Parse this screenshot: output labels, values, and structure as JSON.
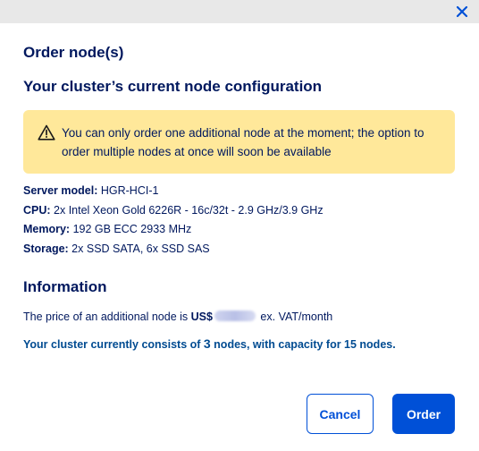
{
  "modal": {
    "title": "Order node(s)",
    "close_icon": "close-icon"
  },
  "config": {
    "title": "Your cluster’s current node configuration",
    "warning": {
      "icon": "warning-icon",
      "text": "You can only order one additional node at the moment; the option to order multiple nodes at once will soon be available"
    },
    "specs": [
      {
        "label": "Server model:",
        "value": " HGR-HCI-1"
      },
      {
        "label": "CPU:",
        "value": " 2x Intel Xeon Gold 6226R - 16c/32t - 2.9 GHz/3.9 GHz"
      },
      {
        "label": "Memory:",
        "value": " 192 GB ECC 2933 MHz"
      },
      {
        "label": "Storage:",
        "value": " 2x SSD SATA, 6x SSD SAS"
      }
    ]
  },
  "information": {
    "title": "Information",
    "price_prefix": "The price of an additional node is ",
    "currency": "US$",
    "price_suffix": " ex. VAT/month",
    "capacity_prefix": "Your cluster currently consists of ",
    "capacity_count": "3",
    "capacity_suffix": " nodes, with capacity for 15 nodes."
  },
  "buttons": {
    "cancel": "Cancel",
    "order": "Order"
  }
}
